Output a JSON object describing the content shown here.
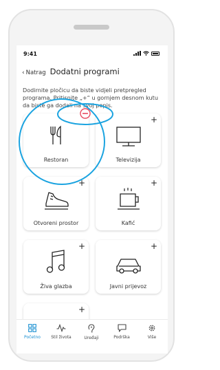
{
  "status_bar": {
    "time": "9:41"
  },
  "header": {
    "back_label": "Natrag",
    "title": "Dodatni programi"
  },
  "description": "Dodirnite pločicu da biste vidjeli pretpregled programa. Pritisnite „+“ u gornjem desnom kutu da biste ga dodali na svoj popis.",
  "tiles": [
    {
      "label": "Restoran",
      "icon": "cutlery-icon",
      "action": "minus"
    },
    {
      "label": "Televizija",
      "icon": "television-icon",
      "action": "+"
    },
    {
      "label": "Otvoreni prostor",
      "icon": "sneaker-icon",
      "action": "+"
    },
    {
      "label": "Kafić",
      "icon": "coffee-cup-icon",
      "action": "+"
    },
    {
      "label": "Živa glazba",
      "icon": "music-note-icon",
      "action": "+"
    },
    {
      "label": "Javni prijevoz",
      "icon": "car-icon",
      "action": "+"
    },
    {
      "label": "",
      "icon": "",
      "action": "+"
    }
  ],
  "tabbar": {
    "items": [
      {
        "label": "Početno",
        "icon": "home-grid-icon",
        "active": true
      },
      {
        "label": "Stil života",
        "icon": "pulse-icon",
        "active": false
      },
      {
        "label": "Uređaji",
        "icon": "hearing-aid-icon",
        "active": false
      },
      {
        "label": "Podrška",
        "icon": "chat-bubble-icon",
        "active": false
      },
      {
        "label": "Više",
        "icon": "gear-icon",
        "active": false
      }
    ]
  },
  "colors": {
    "accent": "#1a8fd1",
    "highlight": "#1aa3e0",
    "minus": "#e84a5f"
  }
}
